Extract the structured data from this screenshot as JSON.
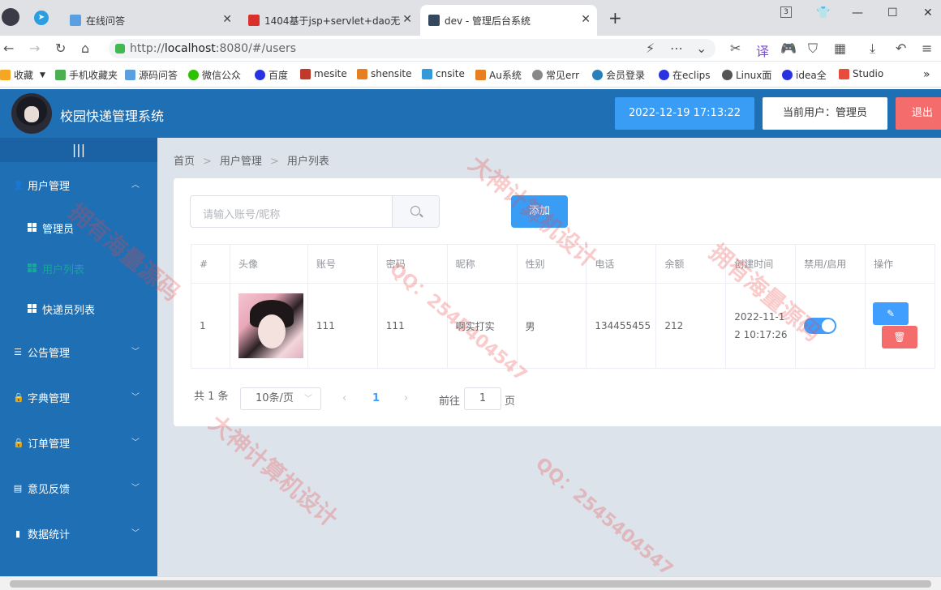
{
  "browser": {
    "tabs": [
      {
        "label": "在线问答",
        "icon_color": "#5aa0e0"
      },
      {
        "label": "1404基于jsp+servlet+dao无",
        "icon_color": "#d9302b"
      },
      {
        "label": "dev - 管理后台系统",
        "icon_color": "#34495e"
      }
    ],
    "tab_counter": "3",
    "url_host": "localhost",
    "url_prefix": "http://",
    "url_rest": ":8080/#/users",
    "bookmarks": [
      {
        "label": "收藏",
        "color": "#f5a623"
      },
      {
        "label": "手机收藏夹",
        "color": "#4caf50"
      },
      {
        "label": "源码问答",
        "color": "#5aa0e0"
      },
      {
        "label": "微信公众",
        "color": "#2dc100"
      },
      {
        "label": "百度",
        "color": "#2932e1"
      },
      {
        "label": "mesite",
        "color": "#c0392b"
      },
      {
        "label": "shensite",
        "color": "#e67e22"
      },
      {
        "label": "cnsite",
        "color": "#3498db"
      },
      {
        "label": "Au系统",
        "color": "#e67e22"
      },
      {
        "label": "常见err",
        "color": "#888888"
      },
      {
        "label": "会员登录",
        "color": "#2980b9"
      },
      {
        "label": "在eclips",
        "color": "#2932e1"
      },
      {
        "label": "Linux面",
        "color": "#555555"
      },
      {
        "label": "idea全",
        "color": "#2932e1"
      },
      {
        "label": "Studio",
        "color": "#e74c3c"
      }
    ]
  },
  "header": {
    "title": "校园快递管理系统",
    "datetime": "2022-12-19 17:13:22",
    "current_user": "当前用户：管理员",
    "logout": "退出"
  },
  "sidebar": {
    "collapse_icon": "|||",
    "menus": [
      {
        "label": "用户管理",
        "icon": "user-icon",
        "expanded": true
      },
      {
        "label": "公告管理",
        "icon": "sliders-icon"
      },
      {
        "label": "字典管理",
        "icon": "lock-icon"
      },
      {
        "label": "订单管理",
        "icon": "lock-icon"
      },
      {
        "label": "意见反馈",
        "icon": "clipboard-icon"
      },
      {
        "label": "数据统计",
        "icon": "bar-chart-icon"
      }
    ],
    "submenus": [
      {
        "label": "管理员"
      },
      {
        "label": "用户列表"
      },
      {
        "label": "快递员列表"
      }
    ]
  },
  "breadcrumb": [
    "首页",
    "用户管理",
    "用户列表"
  ],
  "search": {
    "placeholder": "请输入账号/昵称"
  },
  "add_button": "添加",
  "table": {
    "headers": [
      "#",
      "头像",
      "账号",
      "密码",
      "昵称",
      "性别",
      "电话",
      "余额",
      "创建时间",
      "禁用/启用",
      "操作"
    ],
    "rows": [
      {
        "index": "1",
        "account": "111",
        "password": "111",
        "nickname": "啊实打实",
        "gender": "男",
        "phone": "134455455",
        "balance": "212",
        "created_line1": "2022-11-1",
        "created_line2": "2 10:17:26",
        "enabled": true
      }
    ]
  },
  "pagination": {
    "total": "共 1 条",
    "page_size": "10条/页",
    "current_page": "1",
    "goto_label": "前往",
    "goto_value": "1",
    "page_suffix": "页"
  },
  "watermarks": [
    "大神计算机设计",
    "拥有海量源码",
    "QQ：2545404547"
  ],
  "colors": {
    "header": "#1f6fb5",
    "accent": "#409eff",
    "danger": "#f56c6c",
    "active_menu": "#18a59a"
  }
}
